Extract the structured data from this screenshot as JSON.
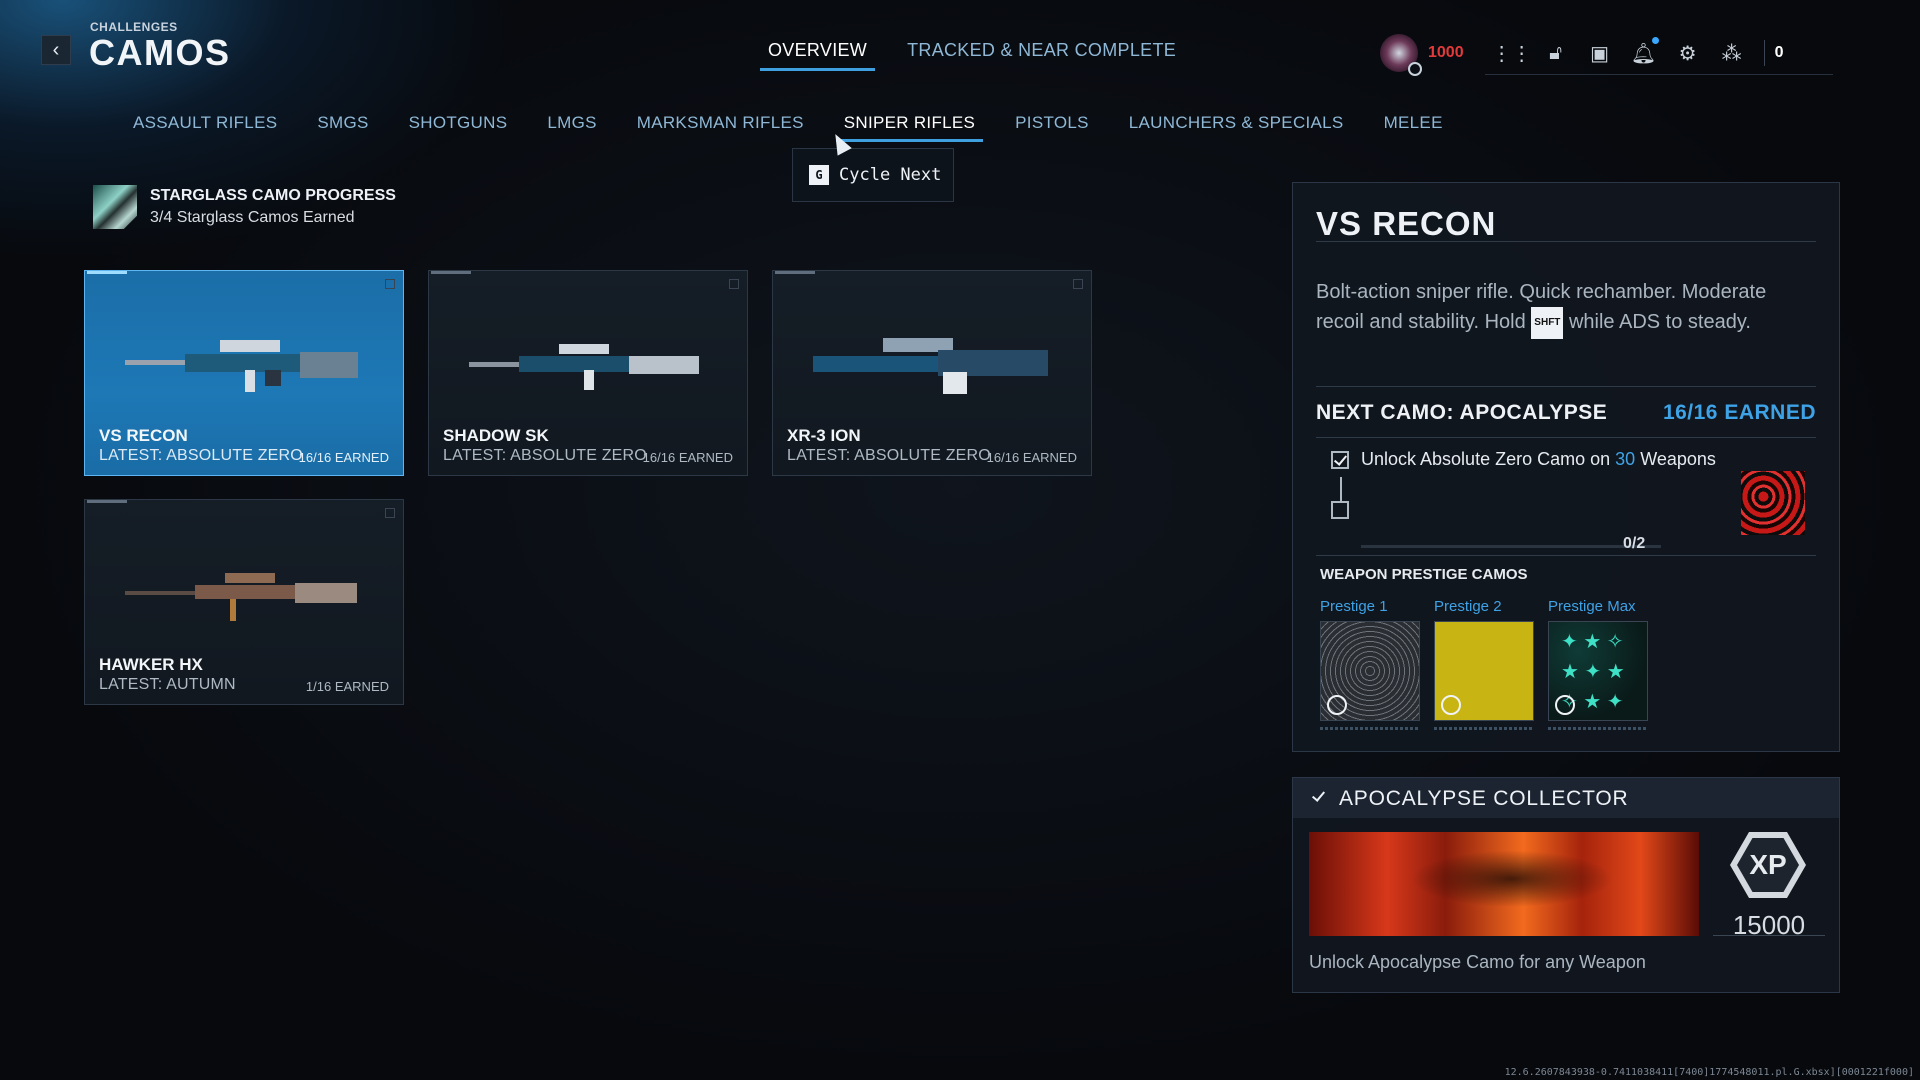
{
  "header": {
    "breadcrumb": "CHALLENGES",
    "title": "CAMOS",
    "top_tabs": [
      {
        "label": "OVERVIEW",
        "active": true
      },
      {
        "label": "TRACKED & NEAR COMPLETE",
        "active": false
      }
    ],
    "hud": {
      "cp_value": "1000",
      "cp_color": "#e23a3a",
      "icons": [
        "apps-grid-icon",
        "lock-icon",
        "camera-icon",
        "bell-icon",
        "gear-icon",
        "party-icon"
      ],
      "party_count": "0"
    }
  },
  "categories": [
    {
      "label": "ASSAULT RIFLES",
      "active": false
    },
    {
      "label": "SMGS",
      "active": false
    },
    {
      "label": "SHOTGUNS",
      "active": false
    },
    {
      "label": "LMGS",
      "active": false
    },
    {
      "label": "MARKSMAN RIFLES",
      "active": false
    },
    {
      "label": "SNIPER RIFLES",
      "active": true
    },
    {
      "label": "PISTOLS",
      "active": false
    },
    {
      "label": "LAUNCHERS & SPECIALS",
      "active": false
    },
    {
      "label": "MELEE",
      "active": false
    }
  ],
  "tooltip": {
    "key": "G",
    "text": "Cycle Next"
  },
  "progress": {
    "label": "STARGLASS CAMO PROGRESS",
    "value": "3/4 Starglass Camos Earned"
  },
  "weapons": [
    {
      "name": "VS RECON",
      "latest": "LATEST: ABSOLUTE ZERO",
      "earned": "16/16 EARNED",
      "selected": true
    },
    {
      "name": "SHADOW SK",
      "latest": "LATEST: ABSOLUTE ZERO",
      "earned": "16/16 EARNED",
      "selected": false
    },
    {
      "name": "XR-3 ION",
      "latest": "LATEST: ABSOLUTE ZERO",
      "earned": "16/16 EARNED",
      "selected": false
    },
    {
      "name": "HAWKER HX",
      "latest": "LATEST: AUTUMN",
      "earned": "1/16 EARNED",
      "selected": false
    }
  ],
  "detail": {
    "title": "VS RECON",
    "desc_part1": "Bolt-action sniper rifle.  Quick rechamber. Moderate recoil and stability.  Hold",
    "desc_key": "SHFT",
    "desc_part2": "while ADS to steady.",
    "next_camo": "NEXT CAMO: APOCALYPSE",
    "next_earned": "16/16 EARNED",
    "task_pre": "Unlock Absolute Zero Camo on",
    "task_num": "30",
    "task_post": "Weapons",
    "task_progress": "0/2",
    "prestige_header": "WEAPON PRESTIGE CAMOS",
    "prestige": [
      {
        "label": "Prestige 1"
      },
      {
        "label": "Prestige 2"
      },
      {
        "label": "Prestige Max"
      }
    ]
  },
  "collector": {
    "title": "APOCALYPSE COLLECTOR",
    "xp_icon": "XP",
    "xp_value": "15000",
    "footer": "Unlock Apocalypse Camo for any Weapon"
  },
  "build_string": "12.6.2607843938-0.7411038411[7400]1774548011.pl.G.xbsx][0001221f000]"
}
